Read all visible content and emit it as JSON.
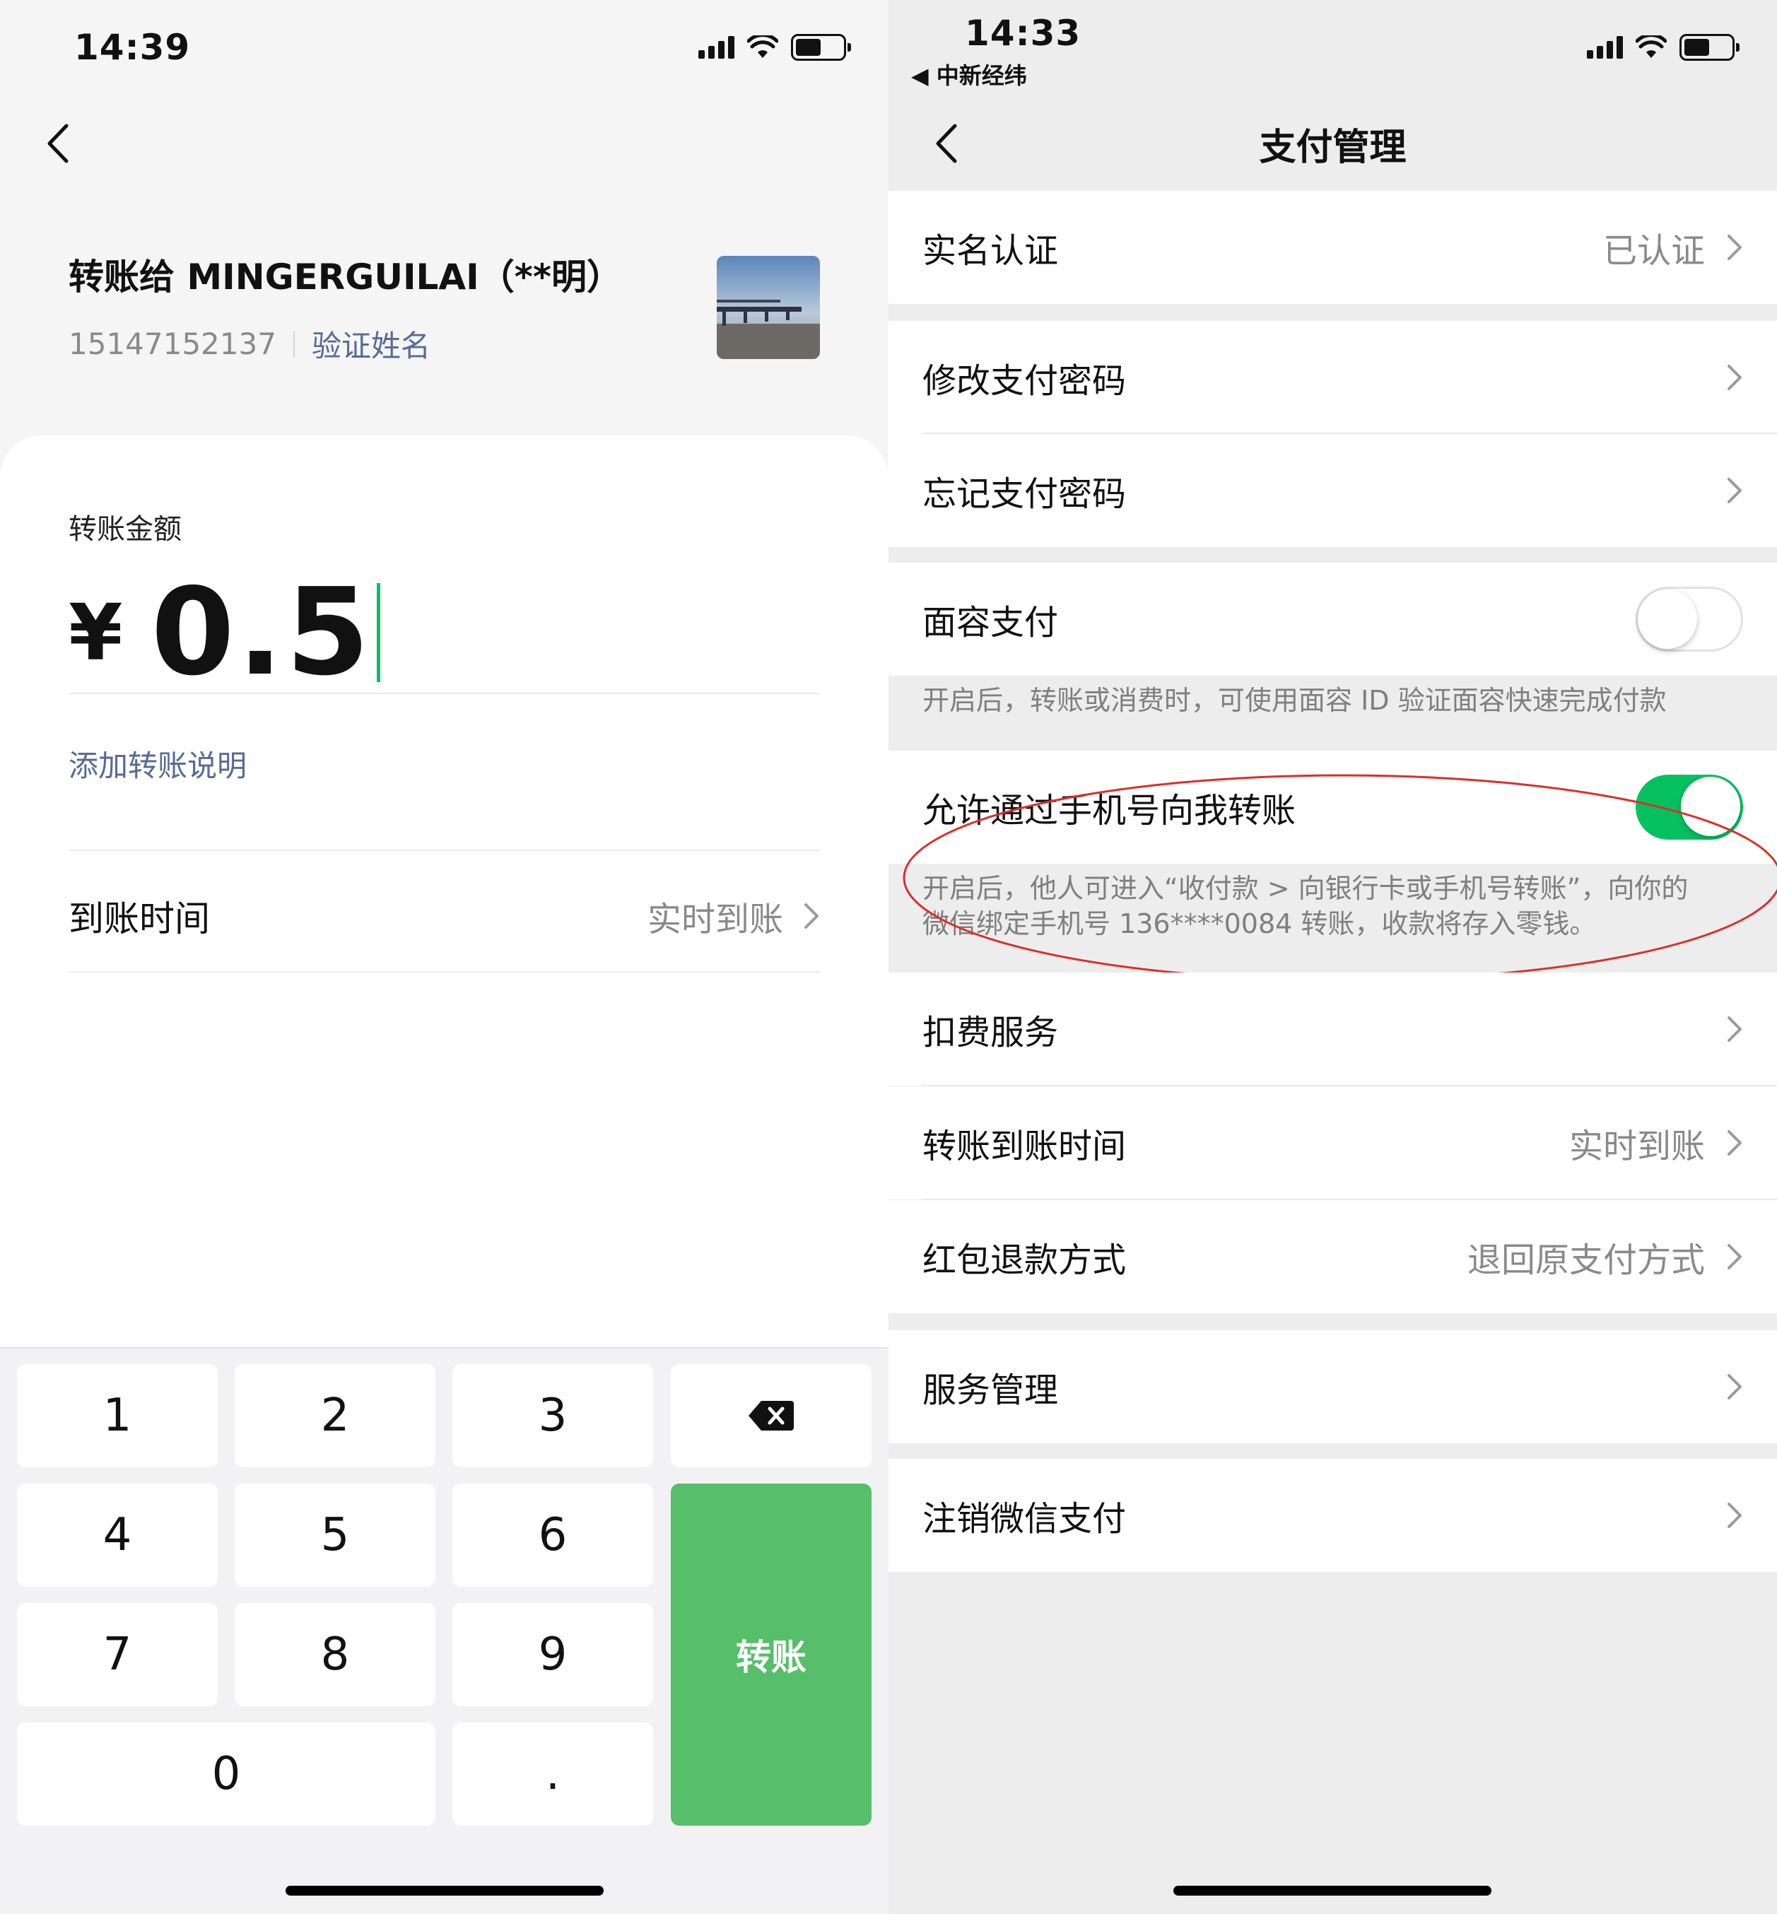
{
  "left": {
    "status": {
      "time": "14:39"
    },
    "recipient": {
      "name": "转账给 MINGERGUILAI（**明）",
      "phone": "15147152137",
      "verify_link": "验证姓名"
    },
    "amount_label": "转账金额",
    "currency": "¥",
    "amount": "0.5",
    "add_note": "添加转账说明",
    "arrival": {
      "label": "到账时间",
      "value": "实时到账"
    },
    "keypad": {
      "keys": [
        "1",
        "2",
        "3",
        "4",
        "5",
        "6",
        "7",
        "8",
        "9",
        "0",
        "."
      ],
      "transfer_label": "转账"
    },
    "colors": {
      "accent": "#57be6a",
      "link": "#576b95"
    }
  },
  "right": {
    "status": {
      "time": "14:33",
      "back_app": "◀ 中新经纬"
    },
    "title": "支付管理",
    "rows": {
      "real_name": {
        "label": "实名认证",
        "value": "已认证"
      },
      "change_pw": {
        "label": "修改支付密码"
      },
      "forgot_pw": {
        "label": "忘记支付密码"
      },
      "face_pay": {
        "label": "面容支付",
        "enabled": false,
        "desc": "开启后，转账或消费时，可使用面容 ID 验证面容快速完成付款"
      },
      "phone_transfer": {
        "label": "允许通过手机号向我转账",
        "enabled": true,
        "desc_line1": "开启后，他人可进入“收付款 > 向银行卡或手机号转账”，向你的",
        "desc_line2": "微信绑定手机号 136****0084 转账，收款将存入零钱。"
      },
      "deduct": {
        "label": "扣费服务"
      },
      "transfer_time": {
        "label": "转账到账时间",
        "value": "实时到账"
      },
      "red_packet_refund": {
        "label": "红包退款方式",
        "value": "退回原支付方式"
      },
      "service_mgmt": {
        "label": "服务管理"
      },
      "cancel_pay": {
        "label": "注销微信支付"
      }
    },
    "colors": {
      "toggle_on": "#07c160",
      "annotation": "#d9302c"
    }
  }
}
